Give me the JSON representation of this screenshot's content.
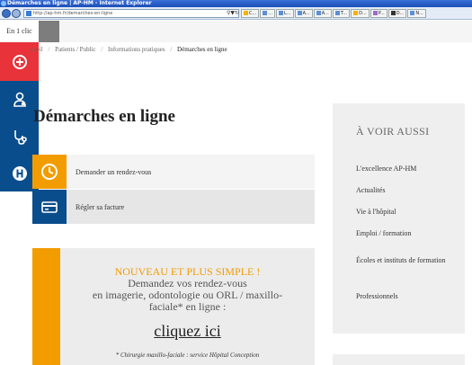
{
  "window": {
    "title": "Démarches en ligne | AP-HM - Internet Explorer",
    "address": "http://ap-hm.fr/demarches-en-ligne"
  },
  "browser_tabs": [
    {
      "label": "C...",
      "color": "#f2b400"
    },
    {
      "label": "...",
      "color": "#5b8fd6"
    },
    {
      "label": "L...",
      "color": "#5b8fd6"
    },
    {
      "label": "A...",
      "color": "#5b8fd6"
    },
    {
      "label": "A...",
      "color": "#5b8fd6"
    },
    {
      "label": "T...",
      "color": "#5b8fd6"
    },
    {
      "label": "D...",
      "color": "#f2b400"
    },
    {
      "label": "P...",
      "color": "#9d6ac9"
    },
    {
      "label": "D...",
      "color": "#333333"
    },
    {
      "label": "N...",
      "color": "#5b8fd6"
    }
  ],
  "quick_access": {
    "header": "En 1 clic",
    "items": [
      {
        "icon": "plus-cross-icon"
      },
      {
        "icon": "doctor-icon"
      },
      {
        "icon": "stethoscope-icon"
      },
      {
        "icon": "hospital-h-icon"
      }
    ]
  },
  "breadcrumb": {
    "items": [
      "cueil",
      "Patients / Public",
      "Informations pratiques",
      "Démarches en ligne"
    ]
  },
  "main": {
    "title": "Démarches en ligne",
    "actions": [
      {
        "label": "Demander un rendez-vous",
        "icon": "clock-icon"
      },
      {
        "label": "Régler sa facture",
        "icon": "credit-card-icon"
      }
    ],
    "promo": {
      "headline": "NOUVEAU ET PLUS SIMPLE !",
      "line1": "Demandez vos rendez-vous",
      "line2": "en imagerie, odontologie ou ORL / maxillo-",
      "line3": "faciale* en ligne :",
      "link": "cliquez ici",
      "note": "* Chirurgie maxillo-faciale : service Hôpital Conception"
    }
  },
  "sidebar": {
    "heading": "À VOIR AUSSI",
    "links": [
      "L'excellence AP-HM",
      "Actualités",
      "Vie à l'hôpital",
      "Emploi / formation",
      "Écoles et instituts de formation",
      "Professionnels"
    ]
  },
  "colors": {
    "red": "#e8333a",
    "navy": "#0a4d8c",
    "orange": "#f29c00"
  }
}
